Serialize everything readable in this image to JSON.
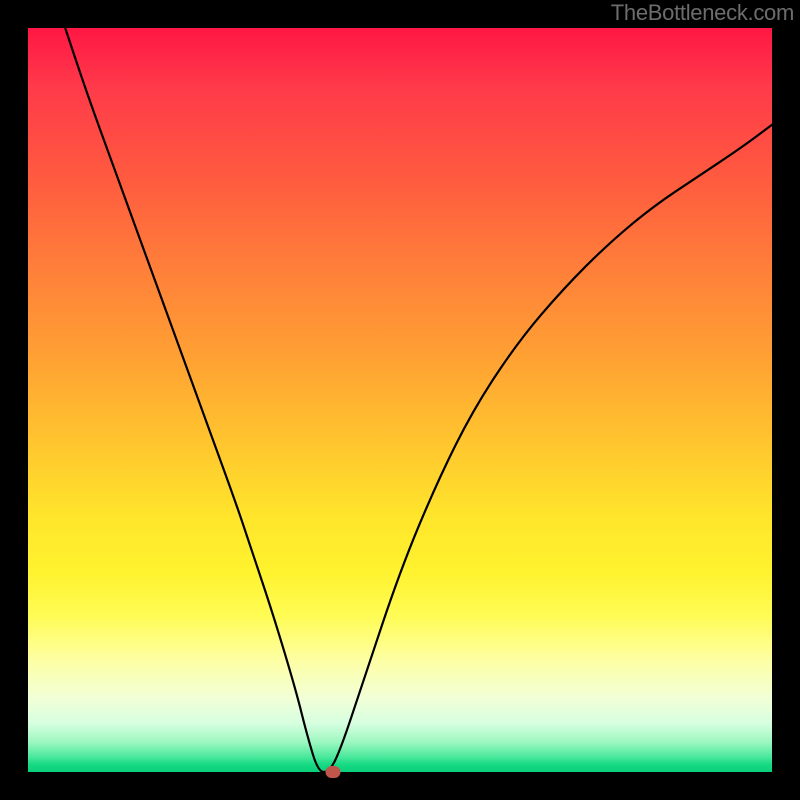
{
  "credit": "TheBottleneck.com",
  "chart_data": {
    "type": "line",
    "title": "",
    "xlabel": "",
    "ylabel": "",
    "xlim": [
      0,
      100
    ],
    "ylim": [
      0,
      100
    ],
    "grid": false,
    "legend": false,
    "background_gradient": {
      "direction": "vertical",
      "stops": [
        {
          "pos": 0,
          "color": "#ff1744"
        },
        {
          "pos": 50,
          "color": "#ffcc2e"
        },
        {
          "pos": 80,
          "color": "#fff96a"
        },
        {
          "pos": 100,
          "color": "#0acf7b"
        }
      ]
    },
    "series": [
      {
        "name": "bottleneck-curve",
        "color": "#000000",
        "x": [
          5,
          8,
          12,
          16,
          20,
          24,
          28,
          30,
          33,
          36,
          37.5,
          39,
          40.5,
          42,
          45,
          50,
          55,
          60,
          66,
          72,
          78,
          84,
          90,
          96,
          100
        ],
        "y": [
          100,
          91,
          80,
          69,
          58,
          47,
          36,
          30,
          21,
          11,
          5,
          0,
          0,
          3,
          12,
          27,
          39,
          49,
          58,
          65,
          71,
          76,
          80,
          84,
          87
        ]
      }
    ],
    "marker": {
      "x": 41,
      "y": 0,
      "color": "#c0554b"
    }
  }
}
